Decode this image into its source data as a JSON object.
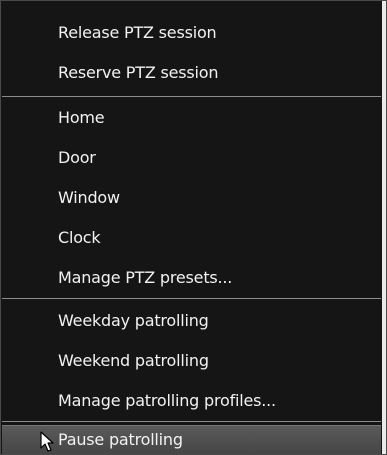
{
  "menu": {
    "groups": [
      {
        "items": [
          {
            "label": "Release PTZ session"
          },
          {
            "label": "Reserve PTZ session"
          }
        ]
      },
      {
        "items": [
          {
            "label": "Home"
          },
          {
            "label": "Door"
          },
          {
            "label": "Window"
          },
          {
            "label": "Clock"
          },
          {
            "label": "Manage PTZ presets..."
          }
        ]
      },
      {
        "items": [
          {
            "label": "Weekday patrolling"
          },
          {
            "label": "Weekend patrolling"
          },
          {
            "label": "Manage patrolling profiles..."
          }
        ]
      },
      {
        "items": [
          {
            "label": "Pause patrolling",
            "state": "hovered"
          }
        ]
      }
    ],
    "colors": {
      "background": "#151515",
      "text": "#f2f2f2",
      "separator": "#8c8c8c",
      "hover": "#4f4f4f"
    },
    "cursor_icon": "arrow-cursor-icon"
  }
}
